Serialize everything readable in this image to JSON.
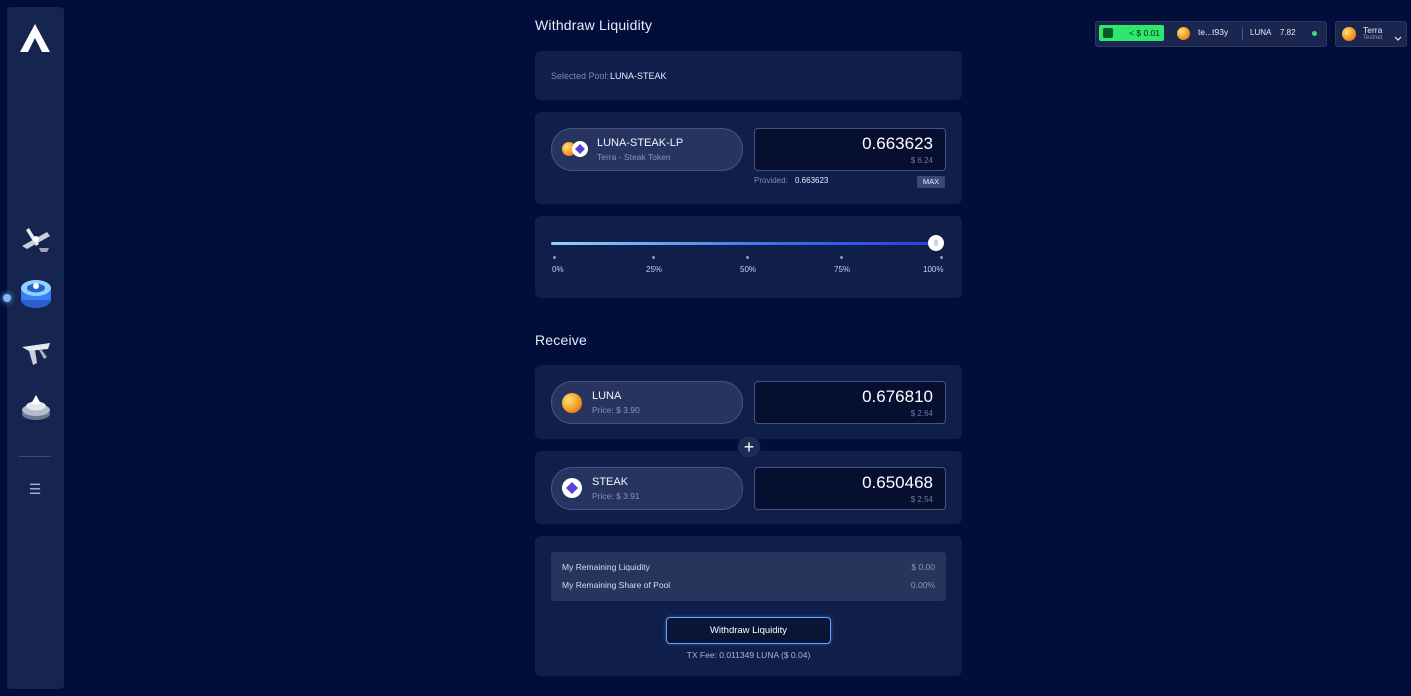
{
  "nav": {
    "logo": "astroport-logo",
    "items": [
      {
        "name": "swap",
        "icon": "swap-icon"
      },
      {
        "name": "pools",
        "icon": "pools-icon",
        "active": true
      },
      {
        "name": "governance",
        "icon": "launch-icon"
      },
      {
        "name": "staking",
        "icon": "staking-icon"
      }
    ],
    "menu_icon": "☰"
  },
  "withdraw": {
    "title": "Withdraw Liquidity",
    "selected_pool_label": "Selected Pool:",
    "selected_pool_value": "LUNA-STEAK",
    "lp_token": {
      "name": "LUNA-STEAK-LP",
      "subtitle": "Terra - Steak Token",
      "amount": "0.663623",
      "usd": "$ 6.24",
      "provided_label": "Provided:",
      "provided_value": "0.663623",
      "max_label": "MAX"
    },
    "slider": {
      "value_percent": 100,
      "ticks": [
        "0%",
        "25%",
        "50%",
        "75%",
        "100%"
      ]
    }
  },
  "receive": {
    "title": "Receive",
    "tokens": [
      {
        "name": "LUNA",
        "price": "Price: $ 3.90",
        "amount": "0.676810",
        "usd": "$ 2.64"
      },
      {
        "name": "STEAK",
        "price": "Price: $ 3.91",
        "amount": "0.650468",
        "usd": "$ 2.54"
      }
    ],
    "plus": "+"
  },
  "summary": {
    "rows": [
      {
        "label": "My Remaining Liquidity",
        "value": "$ 0.00"
      },
      {
        "label": "My Remaining Share of Pool",
        "value": "0.00%"
      }
    ],
    "button_label": "Withdraw Liquidity",
    "tx_fee": "TX Fee: 0.011349 LUNA ($ 0.04)"
  },
  "header": {
    "fee_pill": "< $ 0.01",
    "address": "te...t93y",
    "balance_token": "LUNA",
    "balance_value": "7.82",
    "network_name": "Terra",
    "network_sub": "Testnet"
  },
  "colors": {
    "background": "#020e3a",
    "card": "#101e4a",
    "accent": "#5ca7ff",
    "fee_green": "#2ee86e"
  }
}
